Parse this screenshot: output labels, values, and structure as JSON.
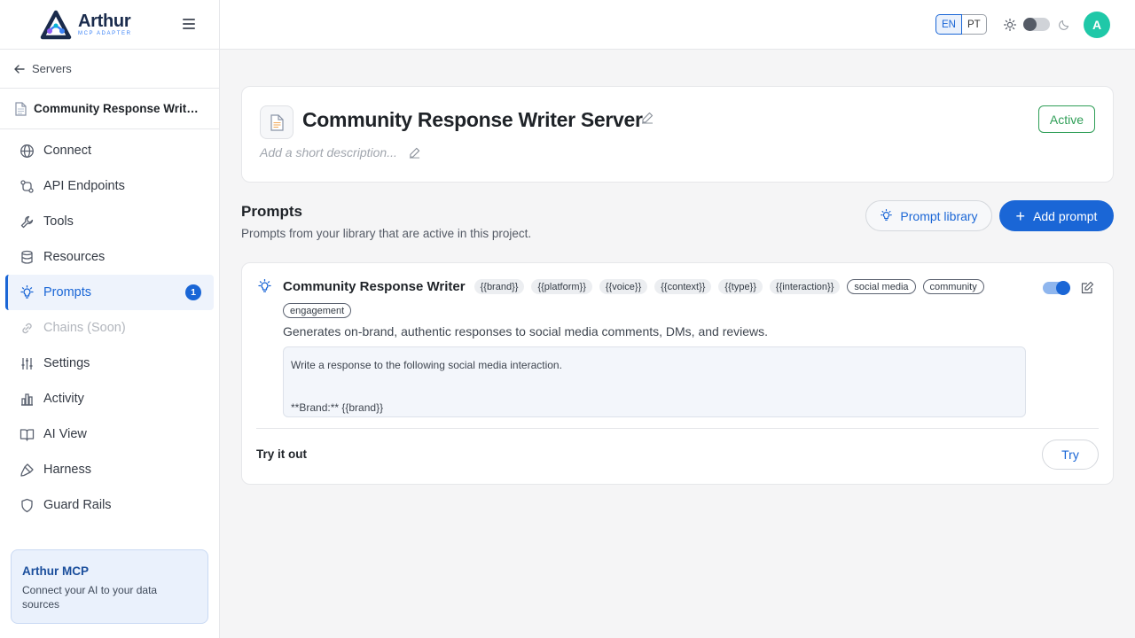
{
  "brand": {
    "name": "Arthur",
    "subtitle": "MCP ADAPTER"
  },
  "sidebar": {
    "back_label": "Servers",
    "server_name": "Community Response Writer ...",
    "items": [
      {
        "label": "Connect",
        "icon": "globe-icon"
      },
      {
        "label": "API Endpoints",
        "icon": "api-icon"
      },
      {
        "label": "Tools",
        "icon": "wrench-icon"
      },
      {
        "label": "Resources",
        "icon": "database-icon"
      },
      {
        "label": "Prompts",
        "icon": "bulb-icon",
        "badge": "1",
        "active": true
      },
      {
        "label": "Chains (Soon)",
        "icon": "link-icon",
        "disabled": true
      },
      {
        "label": "Settings",
        "icon": "sliders-icon"
      },
      {
        "label": "Activity",
        "icon": "bar-chart-icon"
      },
      {
        "label": "AI View",
        "icon": "book-icon"
      },
      {
        "label": "Harness",
        "icon": "pen-tool-icon"
      },
      {
        "label": "Guard Rails",
        "icon": "shield-icon"
      }
    ],
    "promo": {
      "title": "Arthur MCP",
      "text": "Connect your AI to your data sources"
    }
  },
  "header": {
    "lang_en": "EN",
    "lang_pt": "PT",
    "avatar_initial": "A"
  },
  "server": {
    "title": "Community Response Writer Server",
    "description_placeholder": "Add a short description...",
    "status": "Active"
  },
  "prompts_section": {
    "title": "Prompts",
    "subtitle": "Prompts from your library that are active in this project.",
    "library_button": "Prompt library",
    "add_button": "Add prompt"
  },
  "prompt": {
    "name": "Community Response Writer",
    "variables": [
      "{{brand}}",
      "{{platform}}",
      "{{voice}}",
      "{{context}}",
      "{{type}}",
      "{{interaction}}"
    ],
    "tags": [
      "social media",
      "community",
      "engagement"
    ],
    "description": "Generates on-brand, authentic responses to social media comments, DMs, and reviews.",
    "body_lines": [
      "Write a response to the following social media interaction.",
      "**Brand:** {{brand}}"
    ],
    "enabled": true,
    "try_label": "Try it out",
    "try_button": "Try"
  },
  "colors": {
    "accent": "#1a66d6",
    "success": "#2f9e57",
    "avatar": "#1fc8a8"
  }
}
